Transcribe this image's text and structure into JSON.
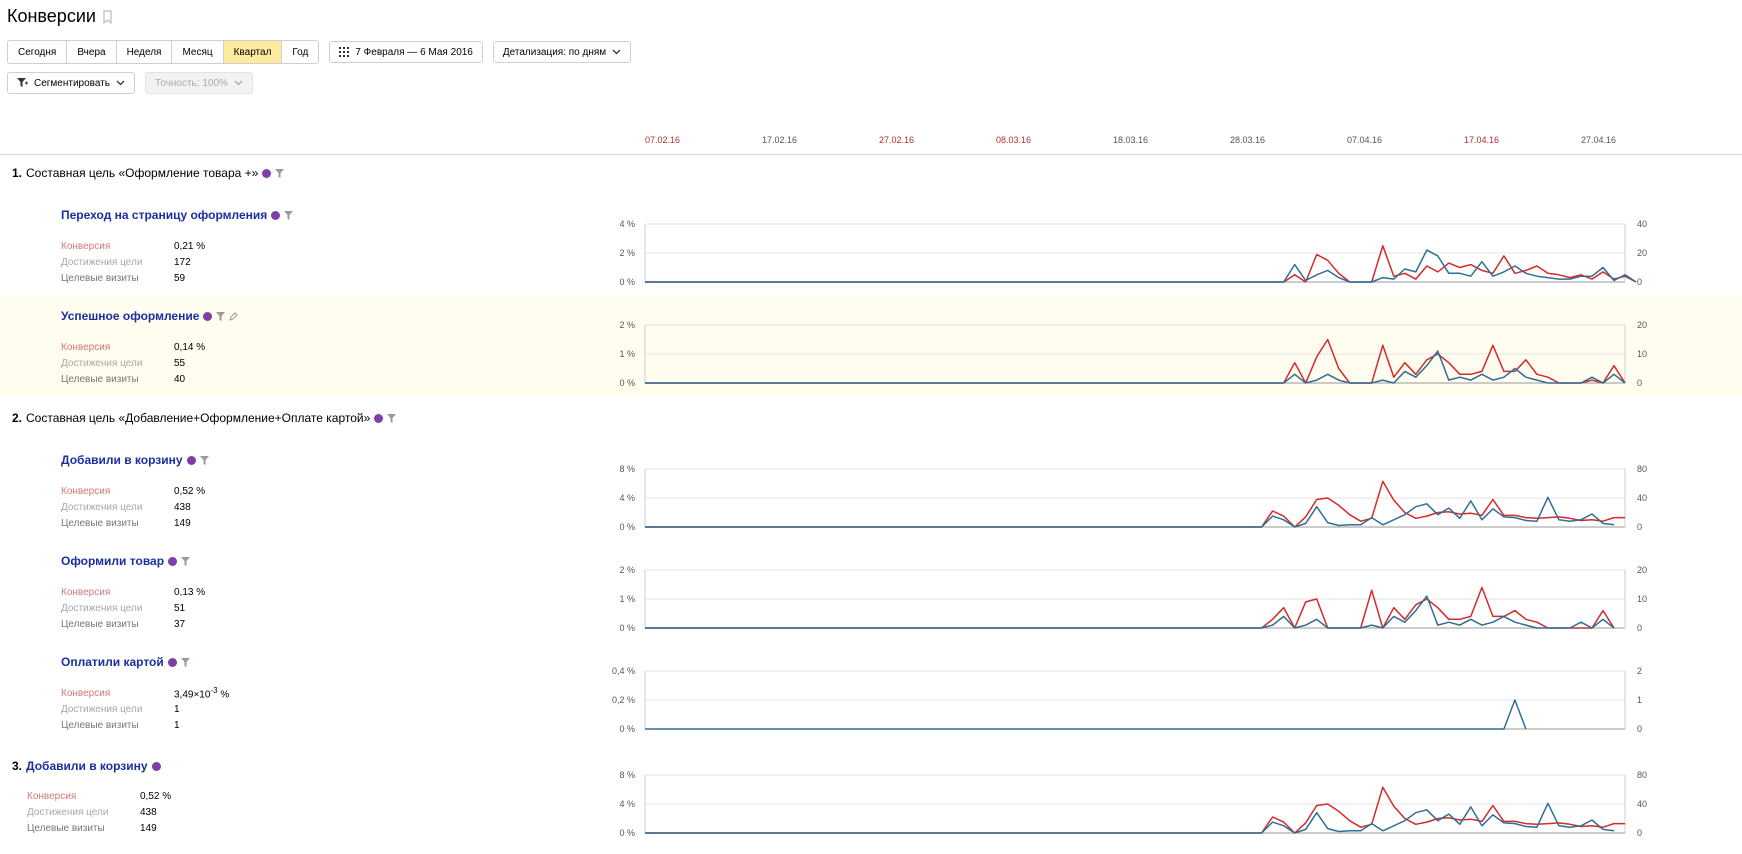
{
  "page": {
    "title": "Конверсии"
  },
  "period_buttons": [
    "Сегодня",
    "Вчера",
    "Неделя",
    "Месяц",
    "Квартал",
    "Год"
  ],
  "period_active": "Квартал",
  "date_range": "7 Февраля — 6 Мая 2016",
  "detail": "Детализация: по дням",
  "segment": "Сегментировать",
  "accuracy": "Точность: 100%",
  "axis_dates": [
    {
      "label": "07.02.16",
      "red": true
    },
    {
      "label": "17.02.16",
      "red": false
    },
    {
      "label": "27.02.16",
      "red": true
    },
    {
      "label": "08.03.16",
      "red": true
    },
    {
      "label": "18.03.16",
      "red": false
    },
    {
      "label": "28.03.16",
      "red": false
    },
    {
      "label": "07.04.16",
      "red": false
    },
    {
      "label": "17.04.16",
      "red": true
    },
    {
      "label": "27.04.16",
      "red": false
    }
  ],
  "metric_labels": {
    "conv": "Конверсия",
    "ach": "Достижения цели",
    "vis": "Целевые визиты"
  },
  "groups": [
    {
      "num": "1.",
      "title": "Составная цель «Оформление товара +»"
    },
    {
      "num": "2.",
      "title": "Составная цель «Добавление+Оформление+Оплате картой»"
    },
    {
      "num": "3.",
      "title": "Добавили в корзину"
    }
  ],
  "goals": [
    {
      "title": "Переход на страницу оформления",
      "conv": "0,21 %",
      "ach": "172",
      "vis": "59",
      "left_ticks": [
        "4 %",
        "2 %",
        "0 %"
      ],
      "right_ticks": [
        "40",
        "20",
        "0"
      ]
    },
    {
      "title": "Успешное оформление",
      "conv": "0,14 %",
      "ach": "55",
      "vis": "40",
      "left_ticks": [
        "2 %",
        "1 %",
        "0 %"
      ],
      "right_ticks": [
        "20",
        "10",
        "0"
      ]
    },
    {
      "title": "Добавили в корзину",
      "conv": "0,52 %",
      "ach": "438",
      "vis": "149",
      "left_ticks": [
        "8 %",
        "4 %",
        "0 %"
      ],
      "right_ticks": [
        "80",
        "40",
        "0"
      ]
    },
    {
      "title": "Оформили товар",
      "conv": "0,13 %",
      "ach": "51",
      "vis": "37",
      "left_ticks": [
        "2 %",
        "1 %",
        "0 %"
      ],
      "right_ticks": [
        "20",
        "10",
        "0"
      ]
    },
    {
      "title": "Оплатили картой",
      "conv_base": "3,49×10",
      "conv_exp": "-3",
      "conv_unit": " %",
      "ach": "1",
      "vis": "1",
      "left_ticks": [
        "0,4 %",
        "0,2 %",
        "0 %"
      ],
      "right_ticks": [
        "2",
        "1",
        "0"
      ]
    },
    {
      "title": "",
      "conv": "0,52 %",
      "ach": "438",
      "vis": "149",
      "left_ticks": [
        "8 %",
        "4 %",
        "0 %"
      ],
      "right_ticks": [
        "80",
        "40",
        "0"
      ]
    }
  ],
  "colors": {
    "red_series": "#d42a2a",
    "blue_series": "#2f6f96",
    "link": "#1a2fa0",
    "active_button": "#ffeba0"
  },
  "chart_data": [
    {
      "type": "line",
      "n": 90,
      "series": [
        {
          "color": "#d42a2a",
          "start": 57,
          "values": [
            0,
            0,
            0.5,
            0,
            1.9,
            1.5,
            0.6,
            0,
            0,
            0,
            2.5,
            0.4,
            0.6,
            0.2,
            1.1,
            0.7,
            1.3,
            1.0,
            1.2,
            0.8,
            0.6,
            1.8,
            0.6,
            0.8,
            1.1,
            0.6,
            0.5,
            0.3,
            0.5,
            0.2,
            0.7,
            0.2,
            0.4,
            0
          ]
        },
        {
          "color": "#2f6f96",
          "start": 57,
          "values": [
            0,
            0,
            1.2,
            0.1,
            0.5,
            0.8,
            0.3,
            0,
            0,
            0,
            0.3,
            0.2,
            0.9,
            0.7,
            2.2,
            1.8,
            0.6,
            0.6,
            0.4,
            1.4,
            0.4,
            0.7,
            1.1,
            0.6,
            0.4,
            0.3,
            0.2,
            0.2,
            0.4,
            0.4,
            1.0,
            0.1,
            0.5,
            0
          ]
        }
      ],
      "ylim": [
        0,
        4
      ]
    },
    {
      "type": "line",
      "n": 90,
      "series": [
        {
          "color": "#d42a2a",
          "start": 57,
          "values": [
            0,
            0,
            0.7,
            0,
            0.9,
            1.5,
            0.5,
            0,
            0,
            0,
            1.3,
            0.2,
            0.7,
            0.3,
            0.8,
            1.0,
            0.7,
            0.3,
            0.3,
            0.4,
            1.3,
            0.4,
            0.4,
            0.8,
            0.3,
            0.2,
            0,
            0,
            0,
            0.1,
            0,
            0.6,
            0
          ]
        },
        {
          "color": "#2f6f96",
          "start": 57,
          "values": [
            0,
            0,
            0.3,
            0,
            0.1,
            0.3,
            0.1,
            0,
            0,
            0,
            0.1,
            0,
            0.4,
            0.2,
            0.6,
            1.1,
            0.1,
            0.2,
            0.1,
            0.3,
            0.1,
            0.2,
            0.5,
            0.2,
            0.1,
            0,
            0,
            0,
            0,
            0.2,
            0,
            0.3,
            0
          ]
        }
      ],
      "ylim": [
        0,
        2
      ]
    },
    {
      "type": "line",
      "n": 90,
      "series": [
        {
          "color": "#d42a2a",
          "start": 56,
          "values": [
            0,
            2.2,
            1.5,
            0,
            1.4,
            3.8,
            4.0,
            3.0,
            1.7,
            0.8,
            1.2,
            6.3,
            3.7,
            2.0,
            1.2,
            1.5,
            2.0,
            2.1,
            1.8,
            1.9,
            1.6,
            3.8,
            1.6,
            1.6,
            1.3,
            1.2,
            1.3,
            1.4,
            1.2,
            0.9,
            1.0,
            0.8,
            1.3,
            1.3
          ]
        },
        {
          "color": "#2f6f96",
          "start": 56,
          "values": [
            0,
            1.5,
            1.0,
            0,
            0.5,
            2.8,
            0.6,
            0.2,
            0.3,
            0.3,
            1.3,
            0.3,
            1.0,
            1.7,
            2.8,
            3.2,
            1.7,
            2.6,
            1.2,
            3.6,
            1.0,
            2.5,
            1.4,
            1.3,
            0.9,
            0.8,
            4.1,
            1.0,
            0.8,
            1.0,
            1.8,
            0.5,
            0.3
          ]
        }
      ],
      "ylim": [
        0,
        8
      ]
    },
    {
      "type": "line",
      "n": 90,
      "series": [
        {
          "color": "#d42a2a",
          "start": 56,
          "values": [
            0,
            0.3,
            0.7,
            0,
            0.9,
            1.0,
            0,
            0,
            0,
            0,
            1.3,
            0,
            0.7,
            0.3,
            0.8,
            1.0,
            0.7,
            0.3,
            0.3,
            0.4,
            1.4,
            0.4,
            0.4,
            0.6,
            0.3,
            0.2,
            0,
            0,
            0,
            0,
            0,
            0.6,
            0
          ]
        },
        {
          "color": "#2f6f96",
          "start": 56,
          "values": [
            0,
            0.1,
            0.4,
            0,
            0.1,
            0.3,
            0,
            0,
            0,
            0,
            0.1,
            0,
            0.4,
            0.2,
            0.6,
            1.1,
            0.1,
            0.2,
            0.1,
            0.3,
            0.1,
            0.2,
            0.4,
            0.2,
            0.1,
            0,
            0,
            0,
            0,
            0.2,
            0,
            0.3,
            0
          ]
        }
      ],
      "ylim": [
        0,
        2
      ]
    },
    {
      "type": "line",
      "n": 90,
      "series": [
        {
          "color": "#2f6f96",
          "start": 78,
          "values": [
            0,
            0.2,
            0
          ]
        }
      ],
      "ylim": [
        0,
        0.4
      ]
    },
    {
      "type": "line",
      "n": 90,
      "series": [
        {
          "color": "#d42a2a",
          "start": 56,
          "values": [
            0,
            2.2,
            1.5,
            0,
            1.4,
            3.8,
            4.0,
            3.0,
            1.7,
            0.8,
            1.2,
            6.3,
            3.7,
            2.0,
            1.2,
            1.5,
            2.0,
            2.1,
            1.8,
            1.9,
            1.6,
            3.8,
            1.6,
            1.6,
            1.3,
            1.2,
            1.3,
            1.4,
            1.2,
            0.9,
            1.0,
            0.8,
            1.3,
            1.3
          ]
        },
        {
          "color": "#2f6f96",
          "start": 56,
          "values": [
            0,
            1.5,
            1.0,
            0,
            0.5,
            2.8,
            0.6,
            0.2,
            0.3,
            0.3,
            1.3,
            0.3,
            1.0,
            1.7,
            2.8,
            3.2,
            1.7,
            2.6,
            1.2,
            3.6,
            1.0,
            2.5,
            1.4,
            1.3,
            0.9,
            0.8,
            4.1,
            1.0,
            0.8,
            1.0,
            1.8,
            0.5,
            0.3
          ]
        }
      ],
      "ylim": [
        0,
        8
      ]
    }
  ]
}
